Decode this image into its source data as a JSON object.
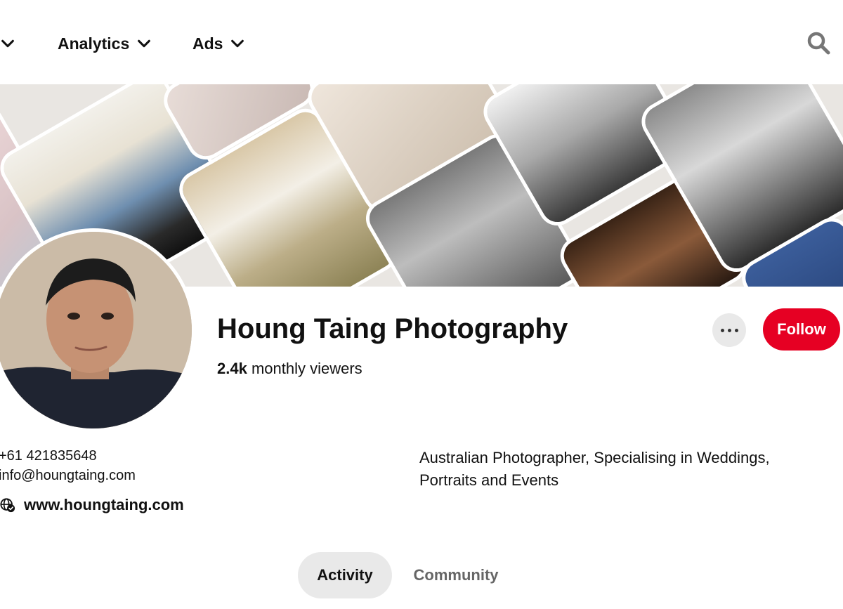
{
  "nav": {
    "items": [
      {
        "label": ""
      },
      {
        "label": "Analytics"
      },
      {
        "label": "Ads"
      }
    ]
  },
  "profile": {
    "name": "Houng Taing Photography",
    "monthly_viewers_count": "2.4k",
    "monthly_viewers_label": " monthly viewers",
    "phone": "+61 421835648",
    "email": "info@houngtaing.com",
    "website": "www.houngtaing.com",
    "bio": "Australian Photographer, Specialising in Weddings, Portraits and Events"
  },
  "actions": {
    "follow_label": "Follow"
  },
  "tabs": [
    {
      "label": "Activity",
      "selected": true
    },
    {
      "label": "Community",
      "selected": false
    }
  ],
  "colors": {
    "accent": "#e60023",
    "tab_selected_bg": "#e9e9e9"
  }
}
